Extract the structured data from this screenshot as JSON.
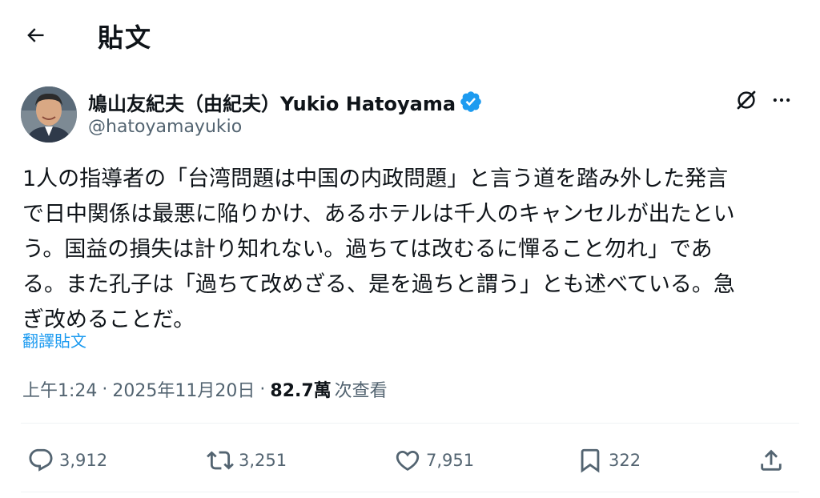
{
  "header": {
    "title": "貼文"
  },
  "author": {
    "display_name": "鳩山友紀夫（由紀夫）Yukio Hatoyama",
    "handle": "@hatoyamayukio",
    "verified": true,
    "verified_color": "#1d9bf0"
  },
  "tweet": {
    "text": "1人の指導者の「台湾問題は中国の内政問題」と言う道を踏み外した発言\nで日中関係は最悪に陥りかけ、あるホテルは千人のキャンセルが出たとい\nう。国益の損失は計り知れない。過ちては改むるに憚ること勿れ」であ\nる。また孔子は「過ちて改めざる、是を過ちと謂う」とも述べている。急\nぎ改めることだ。",
    "translate_label": "翻譯貼文"
  },
  "meta": {
    "time": "上午1:24",
    "date": "2025年11月20日",
    "views_count": "82.7萬",
    "views_label": "次查看"
  },
  "actions": {
    "replies": "3,912",
    "retweets": "3,251",
    "likes": "7,951",
    "bookmarks": "322"
  },
  "icons": {
    "back": "arrow-left-icon",
    "verified": "verified-badge-icon",
    "grok": "grok-icon",
    "more": "more-dots-icon",
    "reply": "reply-icon",
    "retweet": "retweet-icon",
    "like": "heart-icon",
    "bookmark": "bookmark-icon",
    "share": "share-icon"
  },
  "colors": {
    "text_primary": "#0f1419",
    "text_secondary": "#536471",
    "link": "#1d9bf0",
    "divider": "#eff3f4"
  }
}
